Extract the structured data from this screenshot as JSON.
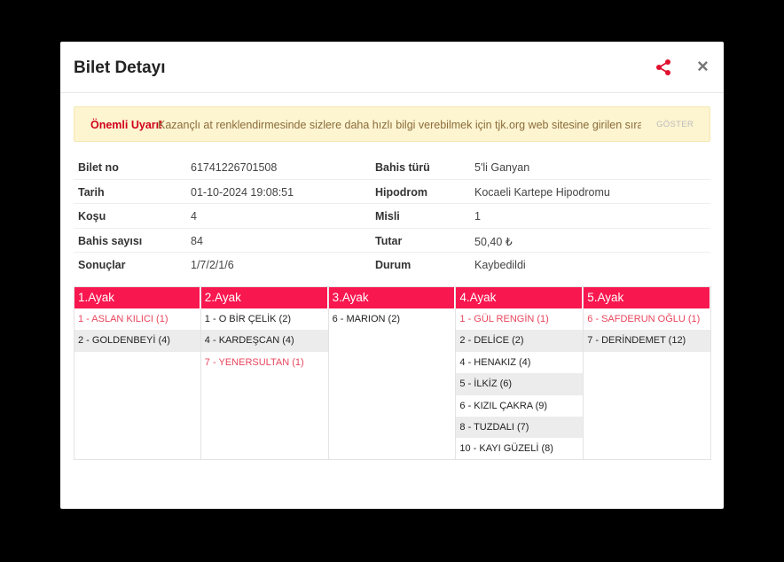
{
  "modal": {
    "title": "Bilet Detayı",
    "close_label": "×"
  },
  "warning": {
    "label": "Önemli Uyarı!",
    "message": "Kazançlı at renklendirmesinde sizlere daha hızlı bilgi verebilmek için tjk.org web sitesine girilen sırala...",
    "show_label": "GÖSTER"
  },
  "info": {
    "rows": [
      {
        "k1": "Bilet no",
        "v1": "61741226701508",
        "k2": "Bahis türü",
        "v2": "5'li Ganyan"
      },
      {
        "k1": "Tarih",
        "v1": "01-10-2024 19:08:51",
        "k2": "Hipodrom",
        "v2": "Kocaeli Kartepe Hipodromu"
      },
      {
        "k1": "Koşu",
        "v1": "4",
        "k2": "Misli",
        "v2": "1"
      },
      {
        "k1": "Bahis sayısı",
        "v1": "84",
        "k2": "Tutar",
        "v2": "50,40 ₺"
      },
      {
        "k1": "Sonuçlar",
        "v1": "1/7/2/1/6",
        "k2": "Durum",
        "v2": "Kaybedildi"
      }
    ]
  },
  "legs": [
    {
      "title": "1.Ayak",
      "horses": [
        {
          "text": "1 - ASLAN KILICI (1)",
          "winner": true
        },
        {
          "text": "2 - GOLDENBEYİ (4)",
          "winner": false
        }
      ]
    },
    {
      "title": "2.Ayak",
      "horses": [
        {
          "text": "1 - O BİR ÇELİK (2)",
          "winner": false
        },
        {
          "text": "4 - KARDEŞCAN (4)",
          "winner": false
        },
        {
          "text": "7 - YENERSULTAN (1)",
          "winner": true
        }
      ]
    },
    {
      "title": "3.Ayak",
      "horses": [
        {
          "text": "6 - MARION (2)",
          "winner": false
        }
      ]
    },
    {
      "title": "4.Ayak",
      "horses": [
        {
          "text": "1 - GÜL RENGİN (1)",
          "winner": true
        },
        {
          "text": "2 - DELİCE (2)",
          "winner": false
        },
        {
          "text": "4 - HENAKIZ (4)",
          "winner": false
        },
        {
          "text": "5 - İLKİZ (6)",
          "winner": false
        },
        {
          "text": "6 - KIZIL ÇAKRA (9)",
          "winner": false
        },
        {
          "text": "8 - TUZDALI (7)",
          "winner": false
        },
        {
          "text": "10 - KAYI GÜZELİ (8)",
          "winner": false
        }
      ]
    },
    {
      "title": "5.Ayak",
      "horses": [
        {
          "text": "6 - SAFDERUN OĞLU (1)",
          "winner": true
        },
        {
          "text": "7 - DERİNDEMET (12)",
          "winner": false
        }
      ]
    }
  ],
  "colors": {
    "accent": "#f8174f",
    "winner_text": "#e8455d",
    "share_icon": "#e0102e"
  }
}
